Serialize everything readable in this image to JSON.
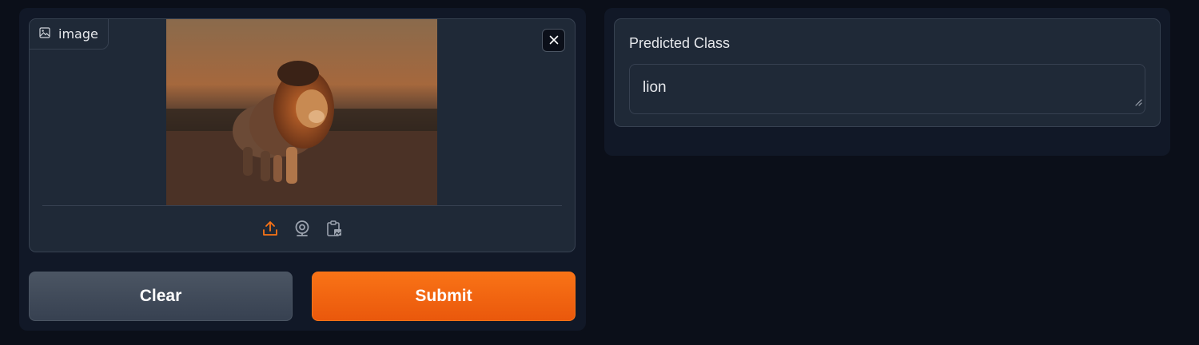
{
  "input": {
    "label": "image",
    "label_icon": "image-icon",
    "close_icon": "close-icon",
    "image_alt": "lion",
    "sources": [
      {
        "name": "upload-icon",
        "color": "#f97316"
      },
      {
        "name": "webcam-icon",
        "color": "#9ca3af"
      },
      {
        "name": "clipboard-image-icon",
        "color": "#9ca3af"
      }
    ]
  },
  "actions": {
    "clear_label": "Clear",
    "submit_label": "Submit"
  },
  "output": {
    "label": "Predicted Class",
    "value": "lion"
  },
  "colors": {
    "background": "#0b0f19",
    "panel": "#111827",
    "block": "#1f2937",
    "border": "#374151",
    "accent": "#f97316",
    "secondary_button": "#4b5563"
  }
}
